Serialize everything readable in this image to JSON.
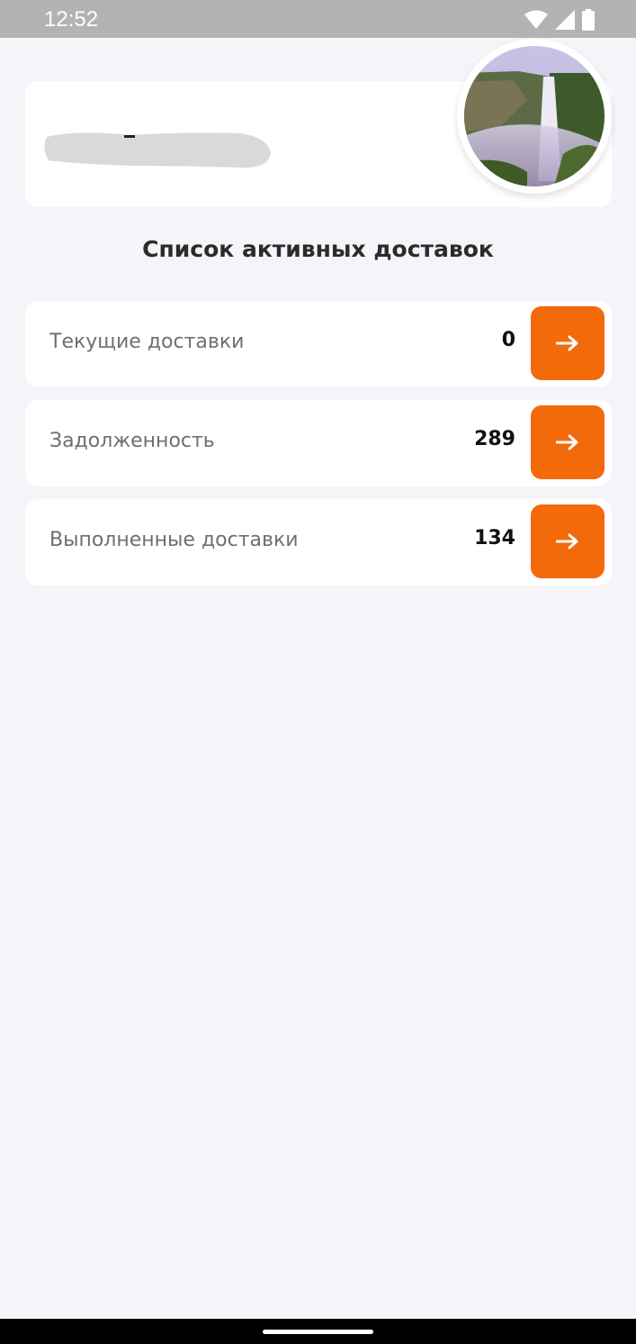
{
  "status_bar": {
    "time": "12:52",
    "icons": [
      "wifi-icon",
      "cellular-signal-icon",
      "battery-icon"
    ]
  },
  "profile": {
    "name_visible": "-",
    "avatar": "waterfall-photo"
  },
  "section": {
    "title": "Список активных доставок"
  },
  "rows": [
    {
      "label": "Текущие доставки",
      "count": "0",
      "button_icon": "arrow-right-icon"
    },
    {
      "label": "Задолженность",
      "count": "289",
      "button_icon": "arrow-right-icon"
    },
    {
      "label": "Выполненные доставки",
      "count": "134",
      "button_icon": "arrow-right-icon"
    }
  ],
  "colors": {
    "accent": "#f26a0a",
    "background": "#f4f4f9",
    "status_bar": "#b3b3b3"
  }
}
